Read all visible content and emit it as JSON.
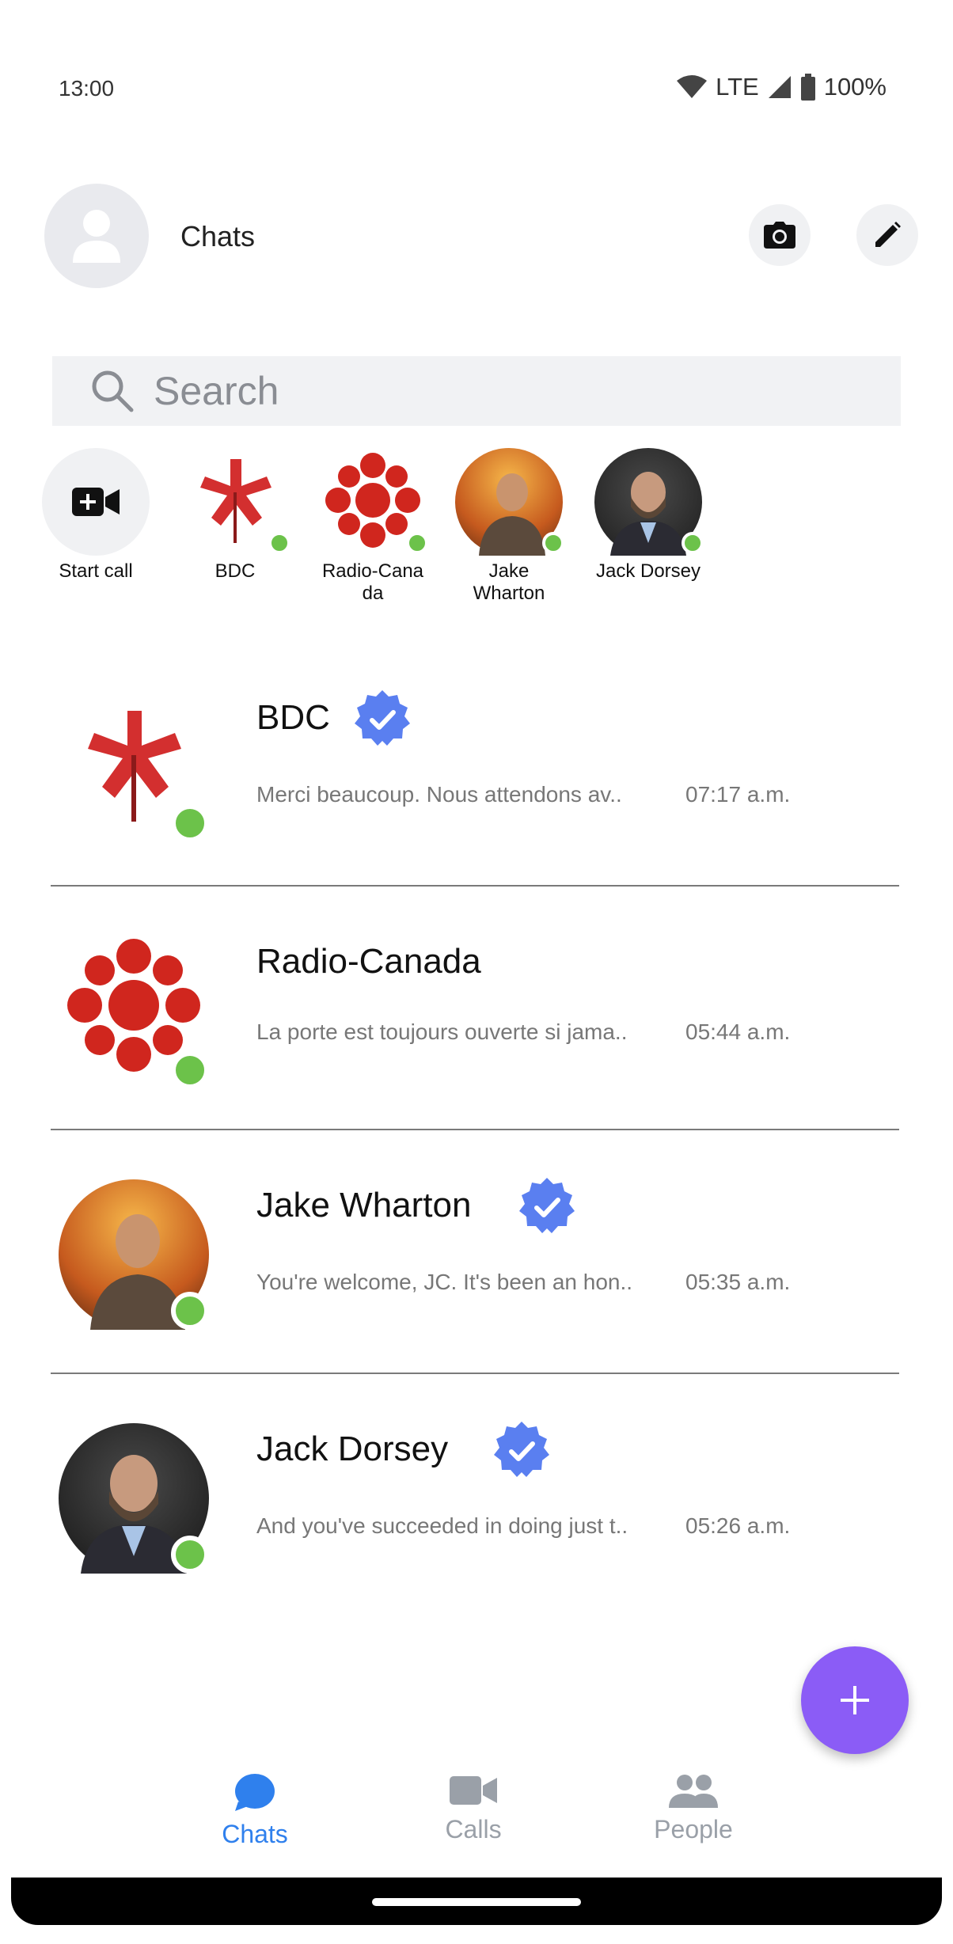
{
  "status_bar": {
    "time": "13:00",
    "network": "LTE",
    "battery": "100%"
  },
  "header": {
    "title": "Chats"
  },
  "search": {
    "placeholder": "Search"
  },
  "stories": [
    {
      "label": "Start call"
    },
    {
      "label": "BDC"
    },
    {
      "label": "Radio-Cana\nda"
    },
    {
      "label": "Jake\nWharton"
    },
    {
      "label": "Jack Dorsey"
    }
  ],
  "chats": [
    {
      "name": "BDC",
      "verified": true,
      "snippet": "Merci beaucoup. Nous attendons av..",
      "time": "07:17 a.m."
    },
    {
      "name": "Radio-Canada",
      "verified": false,
      "snippet": "La porte est toujours ouverte si jama..",
      "time": "05:44 a.m."
    },
    {
      "name": "Jake Wharton",
      "verified": true,
      "snippet": "You're welcome, JC. It's been an hon..",
      "time": "05:35 a.m."
    },
    {
      "name": "Jack Dorsey",
      "verified": true,
      "snippet": "And you've succeeded in doing just t..",
      "time": "05:26 a.m."
    }
  ],
  "bottom_nav": {
    "chats": "Chats",
    "calls": "Calls",
    "people": "People"
  },
  "colors": {
    "accent": "#2f80ed",
    "fab": "#8b5cf6",
    "online": "#6cc24a",
    "verified": "#5a7ff0",
    "inactive": "#9aa0a8"
  }
}
